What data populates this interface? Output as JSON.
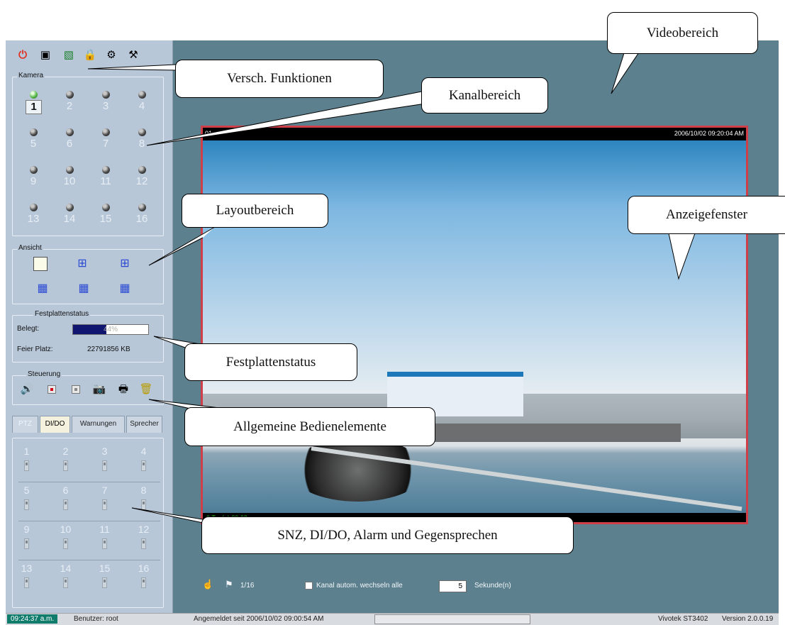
{
  "camera_group_title": "Kamera",
  "view_group_title": "Ansicht",
  "disk_group_title": "Festplattenstatus",
  "control_group_title": "Steuerung",
  "cameras": [
    {
      "label": "1",
      "active": true
    },
    {
      "label": "2"
    },
    {
      "label": "3"
    },
    {
      "label": "4"
    },
    {
      "label": "5"
    },
    {
      "label": "6"
    },
    {
      "label": "7"
    },
    {
      "label": "8"
    },
    {
      "label": "9"
    },
    {
      "label": "10"
    },
    {
      "label": "11"
    },
    {
      "label": "12"
    },
    {
      "label": "13"
    },
    {
      "label": "14"
    },
    {
      "label": "15"
    },
    {
      "label": "16"
    }
  ],
  "disk": {
    "used_label": "Belegt:",
    "used_percent": 44,
    "used_text": "44%",
    "free_label": "Feier Platz:",
    "free_value": "22791856 KB"
  },
  "tabs": [
    "PTZ",
    "DI/DO",
    "Warnungen",
    "Sprecher"
  ],
  "active_tab": "DI/DO",
  "dio_channels": [
    "1",
    "2",
    "3",
    "4",
    "5",
    "6",
    "7",
    "8",
    "9",
    "10",
    "11",
    "12",
    "13",
    "14",
    "15",
    "16"
  ],
  "video": {
    "channel": "01",
    "timestamp": "2006/10/02 09:20:04 AM",
    "bottom_caption": "0 Tag(e) 00:02"
  },
  "bottom_bar": {
    "page": "1/16",
    "auto_switch_label": "Kanal autom. wechseln alle",
    "seconds_value": "5",
    "seconds_label": "Sekunde(n)"
  },
  "statusbar": {
    "time": "09:24:37 a.m.",
    "user": "Benutzer: root",
    "login": "Angemeldet seit  2006/10/02 09:00:54 AM",
    "product": "Vivotek ST3402",
    "version": "Version 2.0.0.19"
  },
  "callouts": {
    "videobereich": "Videobereich",
    "funktionen": "Versch. Funktionen",
    "kanalbereich": "Kanalbereich",
    "layoutbereich": "Layoutbereich",
    "anzeigefenster": "Anzeigefenster",
    "festplattenstatus": "Festplattenstatus",
    "bedienelemente": "Allgemeine Bedienelemente",
    "snz": "SNZ, DI/DO, Alarm und Gegensprechen"
  },
  "colors": {
    "app_background": "#5d808e",
    "panel": "#b7c7d8",
    "video_border": "#cf3f49",
    "disk_fill": "#10156f",
    "status_time": "#107c6c"
  },
  "icons": [
    "power-icon",
    "monitor-icon",
    "display-color-icon",
    "lock-icon",
    "settings-icon",
    "tools-icon"
  ]
}
